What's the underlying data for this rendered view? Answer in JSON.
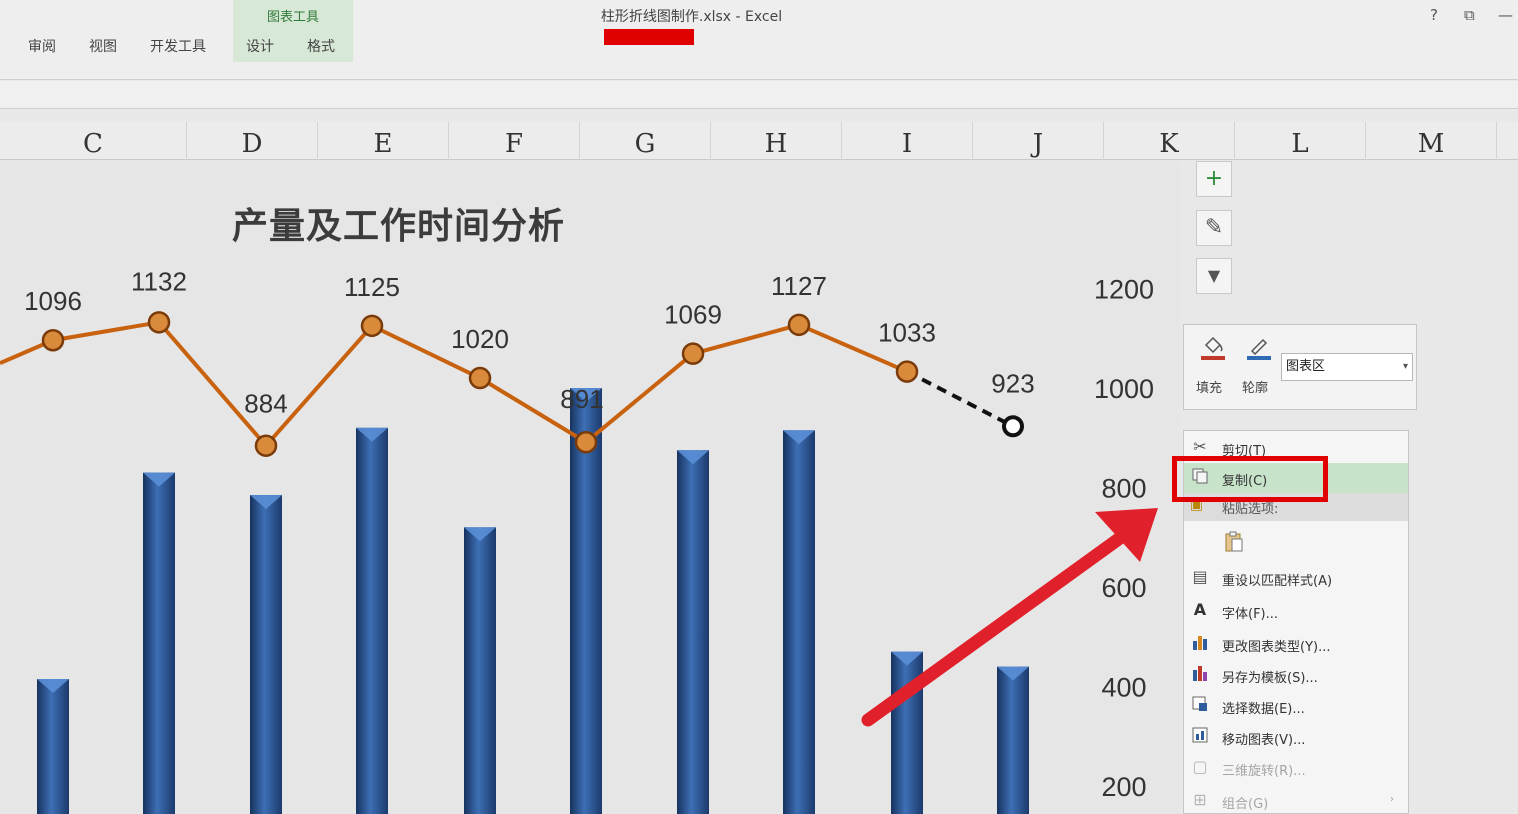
{
  "window": {
    "title": "柱形折线图制作.xlsx - Excel",
    "help": "?",
    "restore": "⧉",
    "minimize": "—"
  },
  "ribbon": {
    "tabs": [
      "审阅",
      "视图",
      "开发工具"
    ],
    "tool_group_title": "图表工具",
    "tool_tabs": [
      "设计",
      "格式"
    ]
  },
  "columns": [
    "C",
    "D",
    "E",
    "F",
    "G",
    "H",
    "I",
    "J",
    "K",
    "L",
    "M"
  ],
  "chart": {
    "title": "产量及工作时间分析",
    "side_buttons": [
      "+",
      "✎",
      "▼"
    ]
  },
  "chart_data": {
    "type": "bar",
    "title": "产量及工作时间分析",
    "yticks": [
      200,
      400,
      600,
      800,
      1000,
      1200
    ],
    "series": [
      {
        "name": "",
        "type": "bar",
        "values": [
          415,
          830,
          785,
          920,
          720,
          1000,
          875,
          915,
          470,
          440
        ]
      },
      {
        "name": "",
        "type": "line",
        "values": [
          1096,
          1132,
          884,
          1125,
          1020,
          891,
          1069,
          1127,
          1033,
          923
        ],
        "labels": [
          "1096",
          "1132",
          "884",
          "1125",
          "1020",
          "891",
          "1069",
          "1127",
          "1033",
          "923"
        ]
      }
    ],
    "colors": {
      "bar": "#2f5c9c",
      "line": "#c8620f",
      "dashed": "#111111"
    }
  },
  "mini_toolbar": {
    "fill_label": "填充",
    "outline_label": "轮廓",
    "select_value": "图表区"
  },
  "context_menu": {
    "items": [
      {
        "label": "剪切(T)",
        "icon": "scissors-icon"
      },
      {
        "label": "复制(C)",
        "icon": "copy-icon"
      },
      {
        "label": "粘贴选项:",
        "icon": "paste-icon"
      },
      {
        "label": "重设以匹配样式(A)",
        "icon": "reset-style-icon"
      },
      {
        "label": "字体(F)...",
        "icon": "font-icon"
      },
      {
        "label": "更改图表类型(Y)...",
        "icon": "chart-type-icon"
      },
      {
        "label": "另存为模板(S)...",
        "icon": "save-template-icon"
      },
      {
        "label": "选择数据(E)...",
        "icon": "select-data-icon"
      },
      {
        "label": "移动图表(V)...",
        "icon": "move-chart-icon"
      },
      {
        "label": "三维旋转(R)...",
        "icon": "rotate-3d-icon"
      },
      {
        "label": "组合(G)",
        "icon": "group-icon"
      }
    ]
  }
}
